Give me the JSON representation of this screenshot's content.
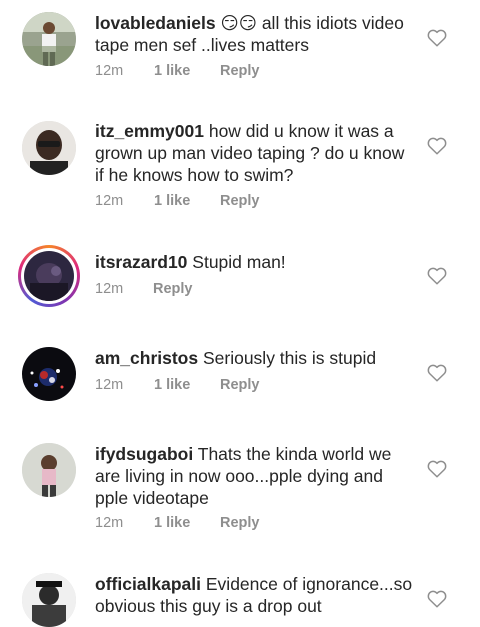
{
  "comments": [
    {
      "username": "lovabledaniels",
      "text": " 😏😏 all this idiots video tape men sef ..lives matters",
      "time": "12m",
      "likes": "1 like",
      "reply": "Reply"
    },
    {
      "username": "itz_emmy001",
      "text": " how did u know it was a grown up man video taping ? do u know if he knows how to swim?",
      "time": "12m",
      "likes": "1 like",
      "reply": "Reply"
    },
    {
      "username": "itsrazard10",
      "text": " Stupid man!",
      "time": "12m",
      "likes": "",
      "reply": "Reply"
    },
    {
      "username": "am_christos",
      "text": " Seriously this is stupid",
      "time": "12m",
      "likes": "1 like",
      "reply": "Reply"
    },
    {
      "username": "ifydsugaboi",
      "text": " Thats the kinda world we are living in now ooo...pple dying and pple videotape",
      "time": "12m",
      "likes": "1 like",
      "reply": "Reply"
    },
    {
      "username": "officialkapali",
      "text": " Evidence of ignorance...so obvious this guy is a drop out",
      "time": "",
      "likes": "",
      "reply": ""
    }
  ],
  "icons": {
    "like": "heart-outline-icon"
  }
}
